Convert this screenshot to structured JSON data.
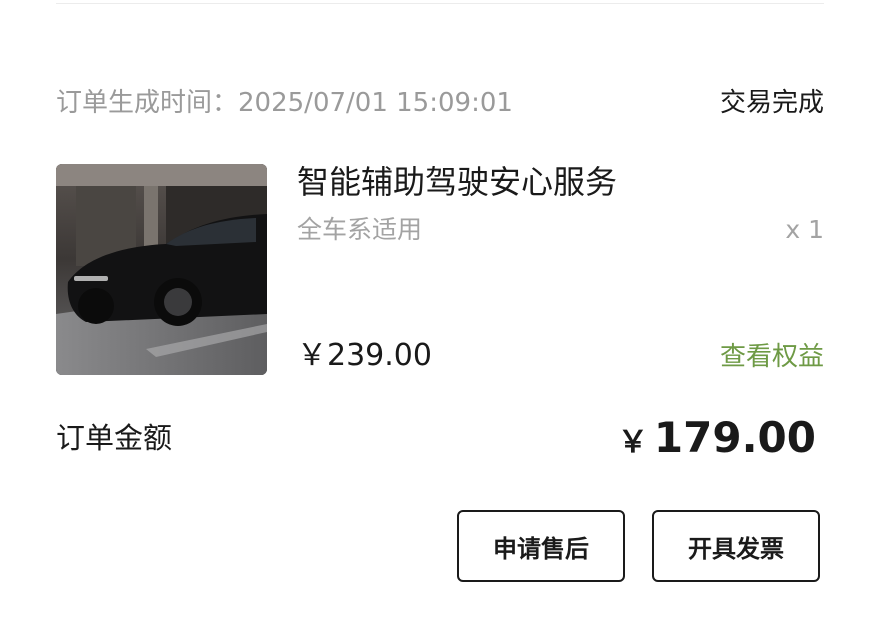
{
  "order": {
    "time_label": "订单生成时间：",
    "time_value": "2025/07/01 15:09:01",
    "status": "交易完成"
  },
  "product": {
    "image_icon": "car-photo-icon",
    "title": "智能辅助驾驶安心服务",
    "subtitle": "全车系适用",
    "quantity": "x 1",
    "price": "￥239.00",
    "benefits_link": "查看权益"
  },
  "total": {
    "label": "订单金额",
    "currency": "￥",
    "value": "179.00"
  },
  "actions": {
    "aftersale_label": "申请售后",
    "invoice_label": "开具发票"
  },
  "colors": {
    "accent_green": "#6e9a45",
    "muted_text": "#9a9a9a",
    "primary_text": "#1a1a1a"
  }
}
